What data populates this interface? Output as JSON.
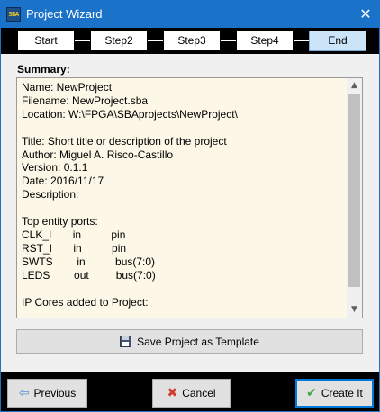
{
  "window": {
    "title": "Project Wizard",
    "app_icon_text": "SBA",
    "close_glyph": "✕"
  },
  "steps": [
    {
      "label": "Start",
      "active": false
    },
    {
      "label": "Step2",
      "active": false
    },
    {
      "label": "Step3",
      "active": false
    },
    {
      "label": "Step4",
      "active": false
    },
    {
      "label": "End",
      "active": true
    }
  ],
  "summary": {
    "label": "Summary:",
    "lines": [
      "Name: NewProject",
      "Filename: NewProject.sba",
      "Location: W:\\FPGA\\SBAprojects\\NewProject\\",
      "",
      "Title: Short title or description of the project",
      "Author: Miguel A. Risco-Castillo",
      "Version: 0.1.1",
      "Date: 2016/11/17",
      "Description:",
      "",
      "Top entity ports:",
      "CLK_I       in          pin",
      "RST_I       in          pin",
      "SWTS        in          bus(7:0)",
      "LEDS        out         bus(7:0)",
      "",
      "IP Cores added to Project:"
    ]
  },
  "buttons": {
    "save_template": "Save Project as Template",
    "previous": "Previous",
    "cancel": "Cancel",
    "create": "Create It"
  },
  "icons": {
    "save": "floppy-disk-icon",
    "previous": "arrow-left-icon",
    "cancel": "cross-icon",
    "create": "check-icon"
  },
  "colors": {
    "titlebar": "#1a73c8",
    "active_step": "#cce4f7",
    "summary_background": "#fdf7e7",
    "default_button_border": "#0078d7"
  }
}
